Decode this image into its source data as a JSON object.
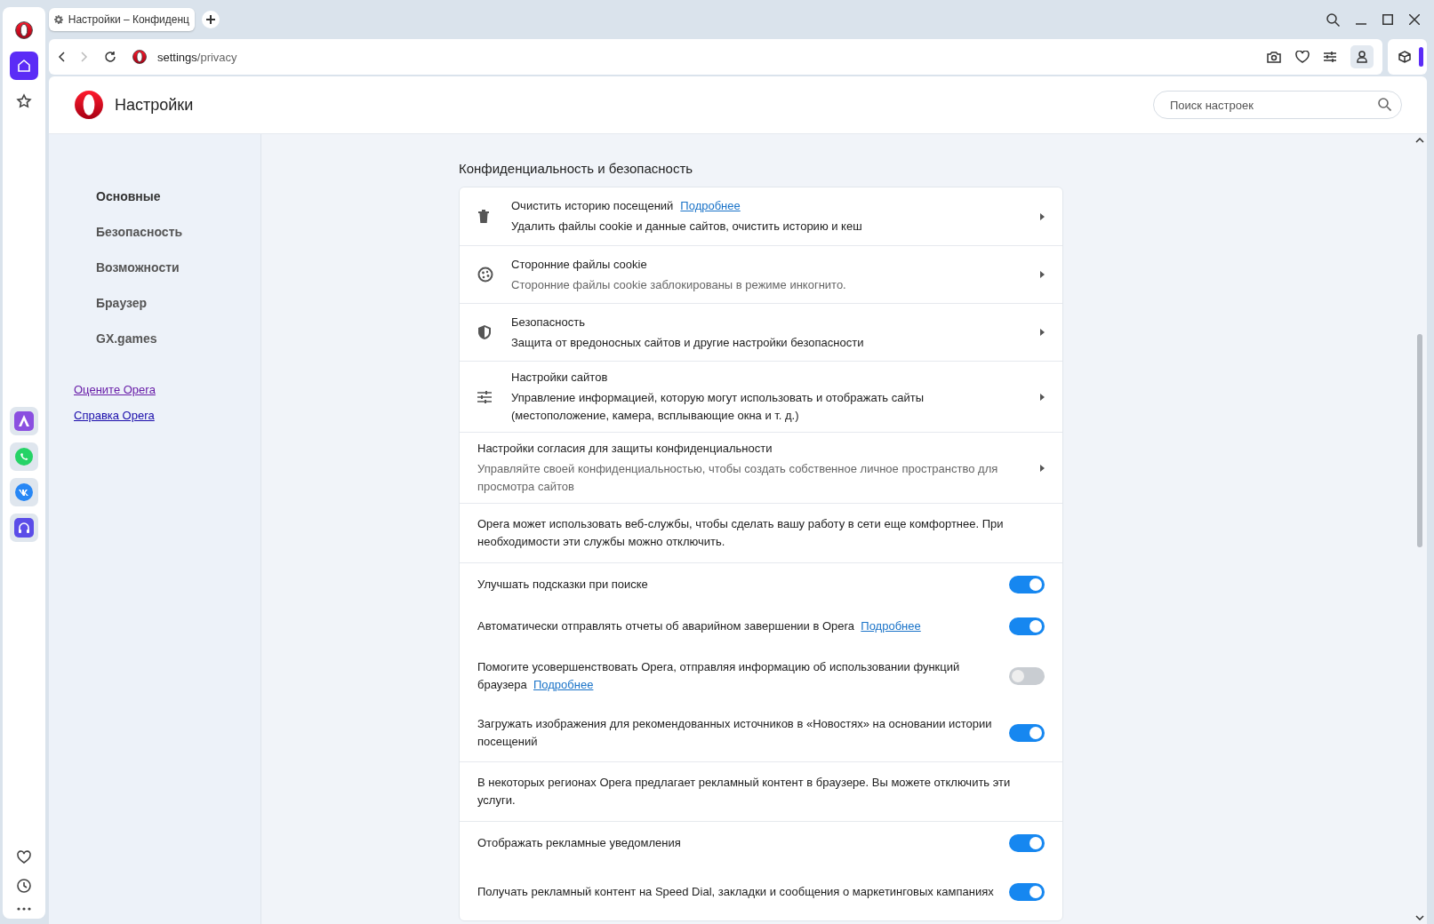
{
  "browser": {
    "tab": {
      "title": "Настройки – Конфиденц"
    },
    "address": {
      "host": "settings",
      "path": "/privacy"
    }
  },
  "rail": {
    "items": [
      {
        "selected": true
      },
      {
        "selected": false
      }
    ]
  },
  "header": {
    "title": "Настройки",
    "search": {
      "placeholder": "Поиск настроек"
    }
  },
  "sidebar": {
    "items": [
      {
        "label": "Основные",
        "selected": true
      },
      {
        "label": "Безопасность",
        "selected": false
      },
      {
        "label": "Возможности",
        "selected": false
      },
      {
        "label": "Браузер",
        "selected": false
      },
      {
        "label": "GX.games",
        "selected": false
      }
    ],
    "links": [
      {
        "label": "Оцените Opera",
        "visited": true
      },
      {
        "label": "Справка Opera",
        "visited": false
      }
    ]
  },
  "section": {
    "title": "Конфиденциальность и безопасность",
    "rows": [
      {
        "kind": "nav",
        "title": "Очистить историю посещений",
        "link": "Подробнее",
        "subtitle": "Удалить файлы cookie и данные сайтов, очистить историю и кеш",
        "muted": false
      },
      {
        "kind": "nav",
        "title": "Сторонние файлы cookie",
        "subtitle": "Сторонние файлы cookie заблокированы в режиме инкогнито.",
        "muted": true
      },
      {
        "kind": "nav",
        "title": "Безопасность",
        "subtitle": "Защита от вредоносных сайтов и другие настройки безопасности",
        "muted": false
      },
      {
        "kind": "nav",
        "title": "Настройки сайтов",
        "subtitle": "Управление информацией, которую могут использовать и отображать сайты (местоположение, камера, всплывающие окна и т. д.)",
        "muted": false
      },
      {
        "kind": "nav",
        "title": "Настройки согласия для защиты конфиденциальности",
        "subtitle": "Управляйте своей конфиденциальностью, чтобы создать собственное личное пространство для просмотра сайтов",
        "muted": true
      },
      {
        "kind": "info",
        "text": "Opera может использовать веб-службы, чтобы сделать вашу работу в сети еще комфортнее. При необходимости эти службы можно отключить."
      },
      {
        "kind": "toggle",
        "label": "Улучшать подсказки при поиске",
        "on": true
      },
      {
        "kind": "toggle",
        "label": "Автоматически отправлять отчеты об аварийном завершении в Opera",
        "link": "Подробнее",
        "on": true
      },
      {
        "kind": "toggle",
        "label": "Помогите усовершенствовать Opera, отправляя информацию об использовании функций браузера",
        "link": "Подробнее",
        "on": false
      },
      {
        "kind": "toggle",
        "label": "Загружать изображения для рекомендованных источников в «Новостях» на основании истории посещений",
        "on": true
      },
      {
        "kind": "info",
        "text": "В некоторых регионах Opera предлагает рекламный контент в браузере. Вы можете отключить эти услуги."
      },
      {
        "kind": "toggle",
        "label": "Отображать рекламные уведомления",
        "on": true
      },
      {
        "kind": "toggle",
        "label": "Получать рекламный контент на Speed Dial, закладки и сообщения о маркетинговых кампаниях",
        "on": true
      }
    ]
  }
}
